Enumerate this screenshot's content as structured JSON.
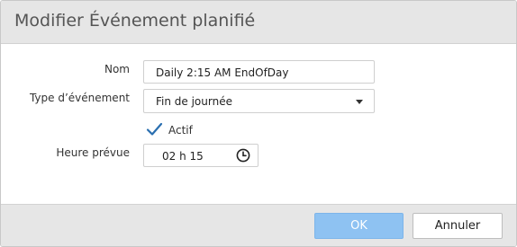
{
  "dialog": {
    "title": "Modifier Événement planifié"
  },
  "form": {
    "name_label": "Nom",
    "name_value": "Daily 2:15 AM EndOfDay",
    "event_type_label": "Type d’événement",
    "event_type_value": "Fin de journée",
    "active_label": "Actif",
    "active_checked": true,
    "time_label": "Heure prévue",
    "time_value": "02 h 15"
  },
  "buttons": {
    "ok_label": "OK",
    "cancel_label": "Annuler"
  },
  "icons": {
    "dropdown": "chevron-down-icon",
    "checkmark": "checkmark-icon",
    "clock": "clock-icon"
  },
  "colors": {
    "header_bg": "#e6e6e6",
    "ok_button_bg": "#8ec2f2",
    "checkmark": "#2a6fb0"
  }
}
